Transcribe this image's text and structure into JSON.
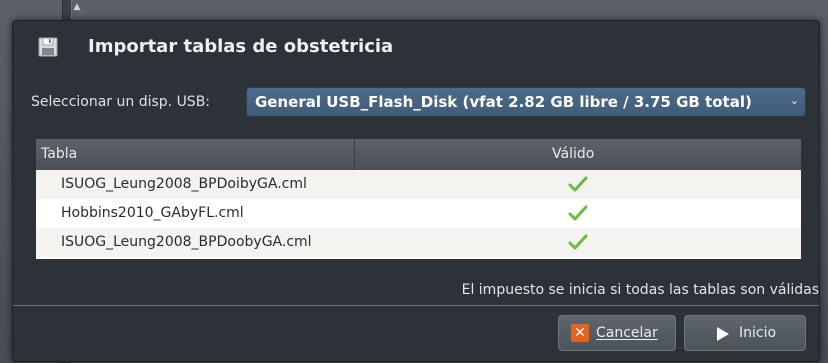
{
  "dialog": {
    "title": "Importar tablas de obstetricia",
    "icon": "floppy-disk-icon"
  },
  "usb": {
    "label": "Seleccionar un disp. USB:",
    "selected_device": "General USB_Flash_Disk (vfat 2.82 GB libre / 3.75 GB total)"
  },
  "table": {
    "columns": [
      "Tabla",
      "Válido"
    ],
    "rows": [
      {
        "name": "ISUOG_Leung2008_BPDoibyGA.cml",
        "valid": "check-icon"
      },
      {
        "name": "Hobbins2010_GAbyFL.cml",
        "valid": "check-icon"
      },
      {
        "name": "ISUOG_Leung2008_BPDoobyGA.cml",
        "valid": "check-icon"
      }
    ]
  },
  "footer": {
    "message": "El impuesto se inicia si todas las tablas son válidas"
  },
  "buttons": {
    "cancel_label": "Cancelar",
    "start_label": "Inicio"
  },
  "colors": {
    "accent": "#4d6c8b",
    "check": "#6dbb3a",
    "cancel_icon": "#e5621a"
  }
}
